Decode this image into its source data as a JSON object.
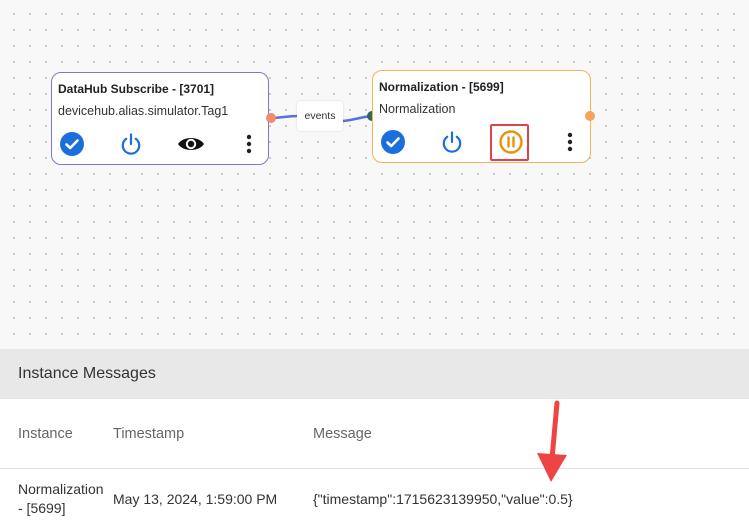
{
  "flow": {
    "nodes": [
      {
        "title": "DataHub Subscribe - [3701]",
        "subtitle": "devicehub.alias.simulator.Tag1",
        "border_color": "#7b78c9",
        "buttons": [
          "check-circle-icon",
          "power-icon",
          "eye-icon",
          "more-vert-icon"
        ]
      },
      {
        "title": "Normalization - [5699]",
        "subtitle": "Normalization",
        "border_color": "#f2b25f",
        "buttons": [
          "check-circle-icon",
          "power-icon",
          "pause-circle-icon",
          "more-vert-icon"
        ]
      }
    ],
    "edge_label": "events"
  },
  "colors": {
    "accent_blue": "#1a6fdc",
    "pause_orange": "#e6920e",
    "highlight_red": "#e0424b",
    "edge_blue": "#5b6ee0"
  },
  "panel": {
    "title": "Instance Messages",
    "columns": [
      "Instance",
      "Timestamp",
      "Message"
    ],
    "rows": [
      {
        "instance": "Normalization - [5699]",
        "timestamp": "May 13, 2024, 1:59:00 PM",
        "message": "{\"timestamp\":1715623139950,\"value\":0.5}"
      }
    ]
  }
}
